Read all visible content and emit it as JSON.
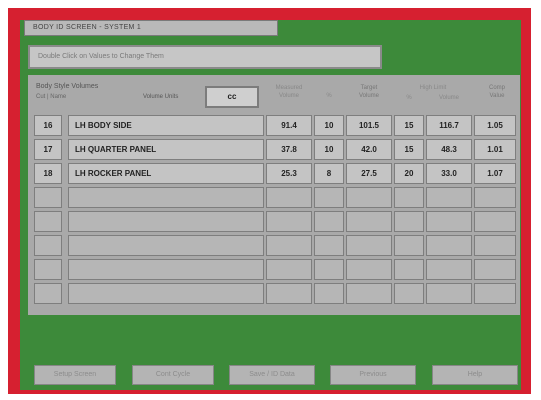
{
  "screen": {
    "title": "BODY ID SCREEN - SYSTEM 1",
    "instruction": "Double Click on Values to Change Them"
  },
  "panel": {
    "heading": "Body Style Volumes",
    "subheading": "Cut | Name",
    "units_label": "Volume Units",
    "units_value": "cc"
  },
  "columns": {
    "measured_line1": "Measured",
    "measured_line2": "Volume",
    "measured_pct": "%",
    "target_line1": "Target",
    "target_line2": "Volume",
    "high_limit_line1": "High Limit",
    "high_limit_pct": "%",
    "high_limit_line2": "Volume",
    "comp_line1": "Comp",
    "comp_line2": "Value"
  },
  "rows": [
    {
      "id": "16",
      "name": "LH BODY SIDE",
      "measured": "91.4",
      "m_pct": "10",
      "target": "101.5",
      "h_pct": "15",
      "high": "116.7",
      "comp": "1.05"
    },
    {
      "id": "17",
      "name": "LH QUARTER PANEL",
      "measured": "37.8",
      "m_pct": "10",
      "target": "42.0",
      "h_pct": "15",
      "high": "48.3",
      "comp": "1.01"
    },
    {
      "id": "18",
      "name": "LH ROCKER PANEL",
      "measured": "25.3",
      "m_pct": "8",
      "target": "27.5",
      "h_pct": "20",
      "high": "33.0",
      "comp": "1.07"
    }
  ],
  "empty_row_count": 5,
  "buttons": {
    "b1": "Setup Screen",
    "b2": "Cont Cycle",
    "b3": "Save / ID Data",
    "b4": "Previous",
    "b5": "Help"
  }
}
